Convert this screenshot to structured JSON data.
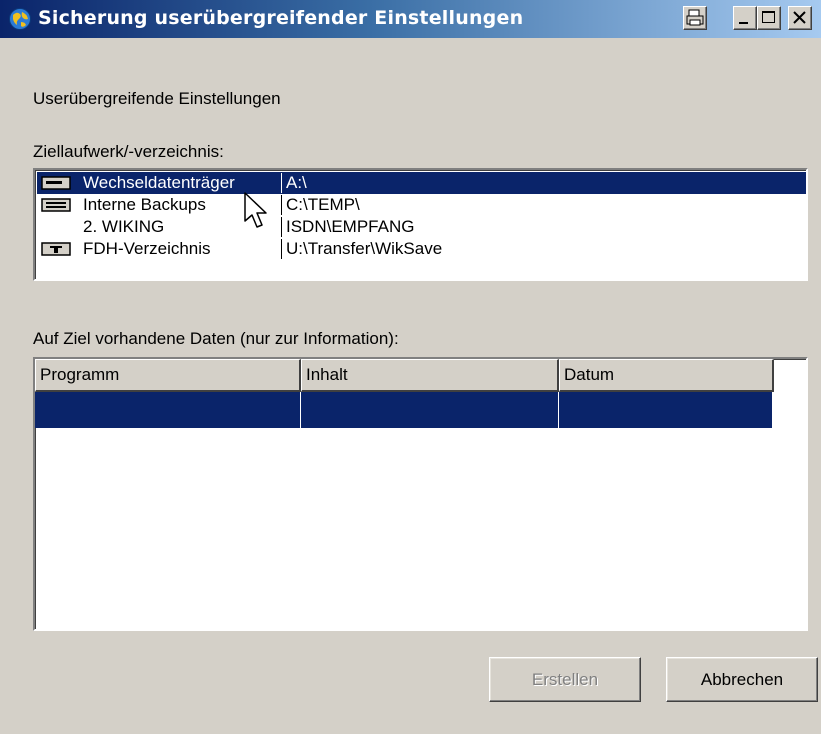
{
  "window": {
    "title": "Sicherung userübergreifender Einstellungen",
    "icon": "globe-icon",
    "controls": [
      "print-icon",
      "minimize-icon",
      "maximize-icon",
      "close-icon"
    ]
  },
  "heading": "Userübergreifende Einstellungen",
  "target": {
    "label": "Ziellaufwerk/-verzeichnis:",
    "items": [
      {
        "name": "Wechseldatenträger",
        "path": "A:\\",
        "icon": "removable-drive-icon",
        "selected": true
      },
      {
        "name": "Interne Backups",
        "path": "C:\\TEMP\\",
        "icon": "hard-drive-icon",
        "selected": false
      },
      {
        "name": "2. WIKING",
        "path": "ISDN\\EMPFANG",
        "icon": "",
        "selected": false
      },
      {
        "name": "FDH-Verzeichnis",
        "path": "U:\\Transfer\\WikSave",
        "icon": "network-drive-icon",
        "selected": false
      }
    ]
  },
  "existing": {
    "label": "Auf Ziel vorhandene Daten (nur zur Information):",
    "columns": [
      "Programm",
      "Inhalt",
      "Datum"
    ],
    "rows": [
      [
        "",
        "",
        ""
      ]
    ]
  },
  "buttons": {
    "create": "Erstellen",
    "cancel": "Abbrechen"
  },
  "colors": {
    "selection": "#0a246a",
    "face": "#d4d0c8"
  }
}
